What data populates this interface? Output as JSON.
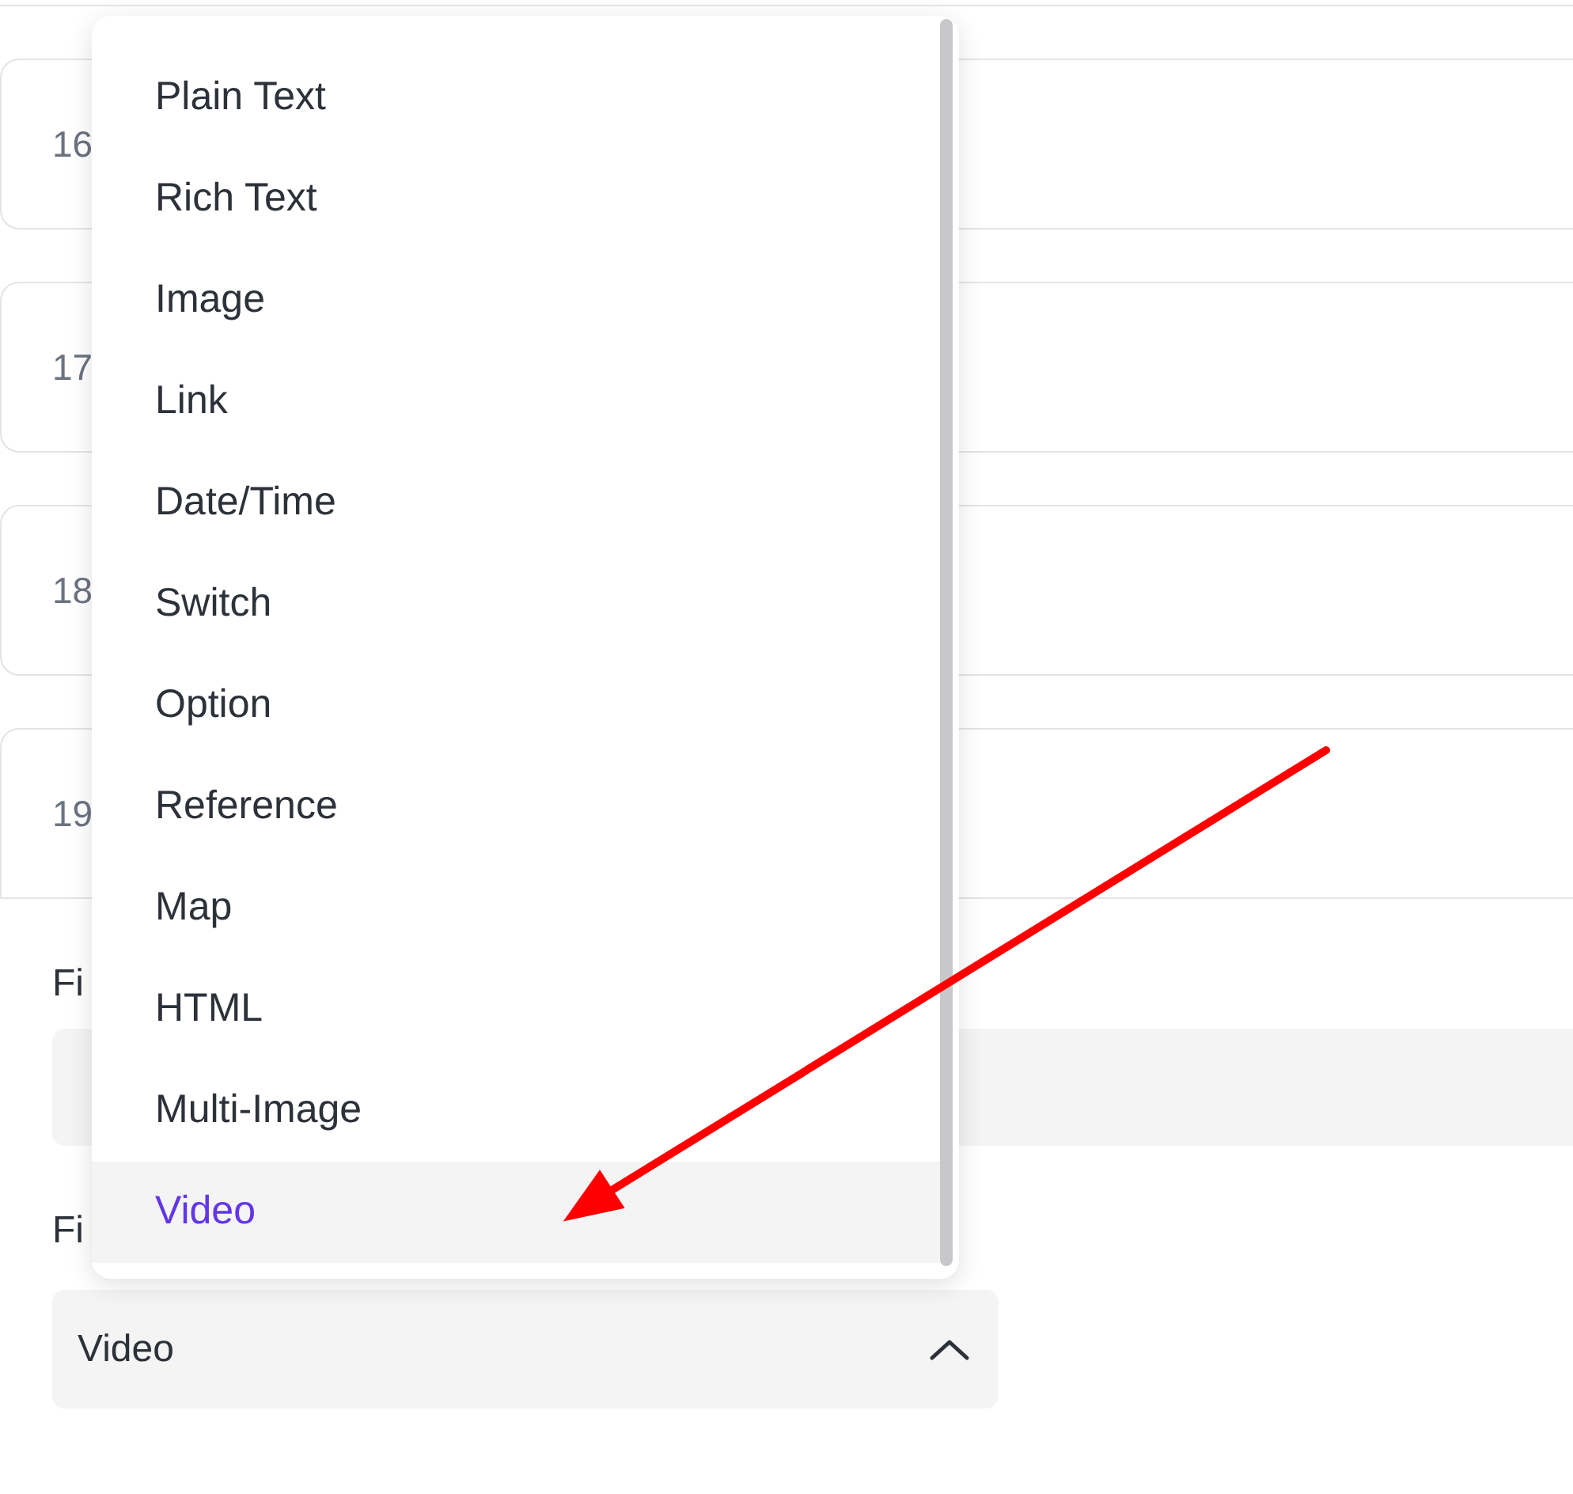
{
  "rows": [
    {
      "number": "16"
    },
    {
      "number": "17"
    },
    {
      "number": "18"
    },
    {
      "number": "19"
    }
  ],
  "name_field": {
    "label": "Fi"
  },
  "type_field": {
    "label": "Fi",
    "value": "Video",
    "expanded": true
  },
  "dropdown": {
    "options": [
      {
        "label": "Plain Text",
        "selected": false
      },
      {
        "label": "Rich Text",
        "selected": false
      },
      {
        "label": "Image",
        "selected": false
      },
      {
        "label": "Link",
        "selected": false
      },
      {
        "label": "Date/Time",
        "selected": false
      },
      {
        "label": "Switch",
        "selected": false
      },
      {
        "label": "Option",
        "selected": false
      },
      {
        "label": "Reference",
        "selected": false
      },
      {
        "label": "Map",
        "selected": false
      },
      {
        "label": "HTML",
        "selected": false
      },
      {
        "label": "Multi-Image",
        "selected": false
      },
      {
        "label": "Video",
        "selected": true
      }
    ]
  }
}
